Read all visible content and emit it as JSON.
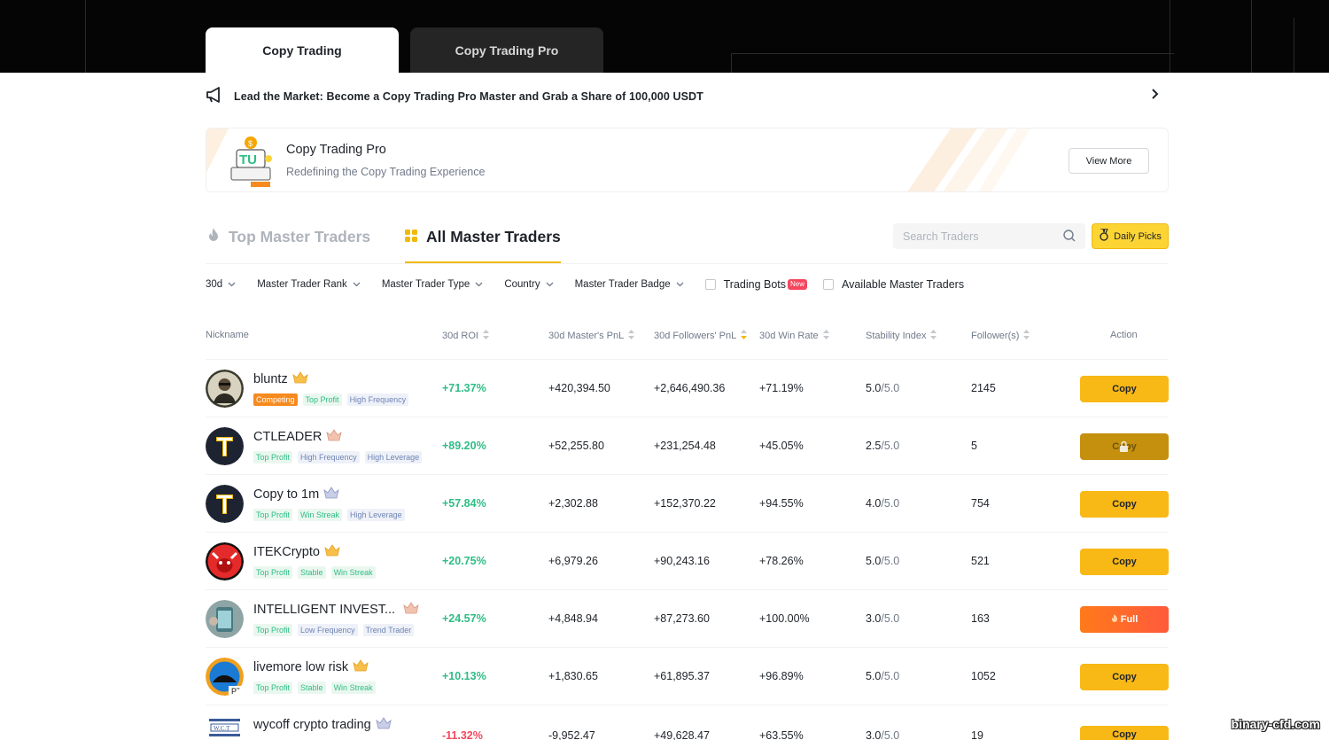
{
  "header": {
    "tabs": [
      {
        "label": "Copy Trading",
        "active": true
      },
      {
        "label": "Copy Trading Pro",
        "active": false
      }
    ]
  },
  "announcement": {
    "text": "Lead the Market: Become a Copy Trading Pro Master and Grab a Share of 100,000 USDT"
  },
  "promo": {
    "title": "Copy Trading Pro",
    "subtitle": "Redefining the Copy Trading Experience",
    "button": "View More"
  },
  "section_tabs": {
    "top": "Top Master Traders",
    "all": "All Master Traders"
  },
  "search": {
    "placeholder": "Search Traders"
  },
  "daily_picks": "Daily Picks",
  "filters": {
    "period": "30d",
    "rank": "Master Trader Rank",
    "type": "Master Trader Type",
    "country": "Country",
    "badge": "Master Trader Badge",
    "trading_bots": "Trading Bots",
    "new_badge": "New",
    "available": "Available Master Traders"
  },
  "table": {
    "columns": {
      "nickname": "Nickname",
      "roi": "30d ROI",
      "pnl": "30d Master's PnL",
      "fpnl": "30d Followers' PnL",
      "win": "30d Win Rate",
      "stab": "Stability Index",
      "fol": "Follower(s)",
      "action": "Action"
    },
    "rows": [
      {
        "name": "bluntz",
        "tags": [
          [
            "Competing",
            "orange"
          ],
          [
            "Top Profit",
            "green"
          ],
          [
            "High Frequency",
            "blue"
          ]
        ],
        "roi": "+71.37%",
        "pnl": "+420,394.50",
        "fpnl": "+2,646,490.36",
        "win": "+71.19%",
        "stab": "5.0",
        "stab_max": "/5.0",
        "fol": "2145",
        "action": "Copy",
        "action_type": "copy"
      },
      {
        "name": "CTLEADER",
        "tags": [
          [
            "Top Profit",
            "green"
          ],
          [
            "High Frequency",
            "blue"
          ],
          [
            "High Leverage",
            "blue"
          ]
        ],
        "roi": "+89.20%",
        "pnl": "+52,255.80",
        "fpnl": "+231,254.48",
        "win": "+45.05%",
        "stab": "2.5",
        "stab_max": "/5.0",
        "fol": "5",
        "action": "Copy",
        "action_type": "locked"
      },
      {
        "name": "Copy to 1m",
        "tags": [
          [
            "Top Profit",
            "green"
          ],
          [
            "Win Streak",
            "green"
          ],
          [
            "High Leverage",
            "blue"
          ]
        ],
        "roi": "+57.84%",
        "pnl": "+2,302.88",
        "fpnl": "+152,370.22",
        "win": "+94.55%",
        "stab": "4.0",
        "stab_max": "/5.0",
        "fol": "754",
        "action": "Copy",
        "action_type": "copy"
      },
      {
        "name": "ITEKCrypto",
        "tags": [
          [
            "Top Profit",
            "green"
          ],
          [
            "Stable",
            "green"
          ],
          [
            "Win Streak",
            "green"
          ]
        ],
        "roi": "+20.75%",
        "pnl": "+6,979.26",
        "fpnl": "+90,243.16",
        "win": "+78.26%",
        "stab": "5.0",
        "stab_max": "/5.0",
        "fol": "521",
        "action": "Copy",
        "action_type": "copy"
      },
      {
        "name": "INTELLIGENT INVEST...",
        "tags": [
          [
            "Top Profit",
            "green"
          ],
          [
            "Low Frequency",
            "blue"
          ],
          [
            "Trend Trader",
            "blue"
          ]
        ],
        "roi": "+24.57%",
        "pnl": "+4,848.94",
        "fpnl": "+87,273.60",
        "win": "+100.00%",
        "stab": "3.0",
        "stab_max": "/5.0",
        "fol": "163",
        "action": "Full",
        "action_type": "full"
      },
      {
        "name": "livemore low risk",
        "tags": [
          [
            "Top Profit",
            "green"
          ],
          [
            "Stable",
            "green"
          ],
          [
            "Win Streak",
            "green"
          ]
        ],
        "roi": "+10.13%",
        "pnl": "+1,830.65",
        "fpnl": "+61,895.37",
        "win": "+96.89%",
        "stab": "5.0",
        "stab_max": "/5.0",
        "fol": "1052",
        "action": "Copy",
        "action_type": "copy"
      },
      {
        "name": "wycoff crypto trading",
        "tags": [],
        "roi": "-11.32%",
        "pnl": "-9,952.47",
        "fpnl": "+49,628.47",
        "win": "+63.55%",
        "stab": "3.0",
        "stab_max": "/5.0",
        "fol": "19",
        "action": "Copy",
        "action_type": "copy"
      }
    ]
  },
  "watermark": "binary-cfd.com",
  "colors": {
    "accent": "#f8b816",
    "positive": "#2ebd85",
    "negative": "#f6465d"
  }
}
